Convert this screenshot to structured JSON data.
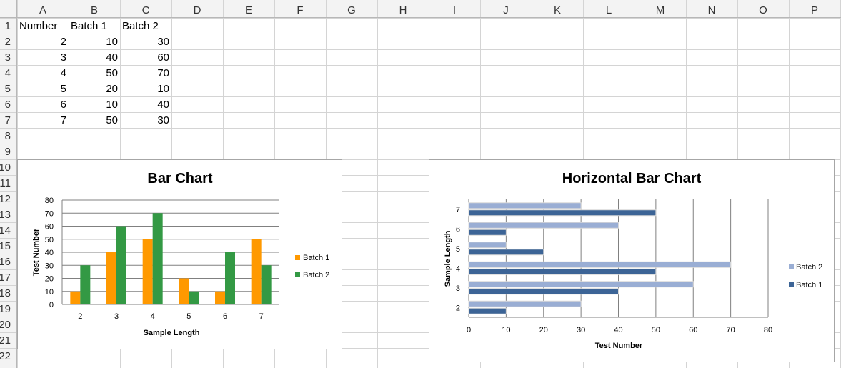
{
  "sheet": {
    "columns": [
      "A",
      "B",
      "C",
      "D",
      "E",
      "F",
      "G",
      "H",
      "I",
      "J",
      "K",
      "L",
      "M",
      "N",
      "O",
      "P"
    ],
    "rows": [
      "1",
      "2",
      "3",
      "4",
      "5",
      "6",
      "7",
      "8",
      "9",
      "10",
      "11",
      "12",
      "13",
      "14",
      "15",
      "16",
      "17",
      "18",
      "19",
      "20",
      "21",
      "22"
    ],
    "cells": [
      [
        "Number",
        "Batch 1",
        "Batch 2"
      ],
      [
        "2",
        "10",
        "30"
      ],
      [
        "3",
        "40",
        "60"
      ],
      [
        "4",
        "50",
        "70"
      ],
      [
        "5",
        "20",
        "10"
      ],
      [
        "6",
        "10",
        "40"
      ],
      [
        "7",
        "50",
        "30"
      ]
    ]
  },
  "colors": {
    "grid": "#d4d4d4",
    "header_bg": "#f3f3f3",
    "header_text": "#333333",
    "batch1_bar": "#ff9900",
    "batch2_bar": "#339944",
    "hbar_batch2": "#9aaed4",
    "hbar_batch1": "#3c6496"
  },
  "chart_data": [
    {
      "type": "bar",
      "title": "Bar Chart",
      "xlabel": "Sample Length",
      "ylabel": "Test Number",
      "categories": [
        "2",
        "3",
        "4",
        "5",
        "6",
        "7"
      ],
      "series": [
        {
          "name": "Batch 1",
          "values": [
            10,
            40,
            50,
            20,
            10,
            50
          ]
        },
        {
          "name": "Batch 2",
          "values": [
            30,
            60,
            70,
            10,
            40,
            30
          ]
        }
      ],
      "ylim": [
        0,
        80
      ],
      "yticks": [
        "0",
        "10",
        "20",
        "30",
        "40",
        "50",
        "60",
        "70",
        "80"
      ],
      "grid": true,
      "legend": "right"
    },
    {
      "type": "bar",
      "orientation": "horizontal",
      "title": "Horizontal Bar Chart",
      "xlabel": "Test Number",
      "ylabel": "Sample Length",
      "categories": [
        "2",
        "3",
        "4",
        "5",
        "6",
        "7"
      ],
      "series": [
        {
          "name": "Batch 1",
          "values": [
            10,
            40,
            50,
            20,
            10,
            50
          ]
        },
        {
          "name": "Batch 2",
          "values": [
            30,
            60,
            70,
            10,
            40,
            30
          ]
        }
      ],
      "xlim": [
        0,
        80
      ],
      "xticks": [
        "0",
        "10",
        "20",
        "30",
        "40",
        "50",
        "60",
        "70",
        "80"
      ],
      "legend_order": [
        "Batch 2",
        "Batch 1"
      ],
      "grid": true,
      "legend": "right"
    }
  ]
}
